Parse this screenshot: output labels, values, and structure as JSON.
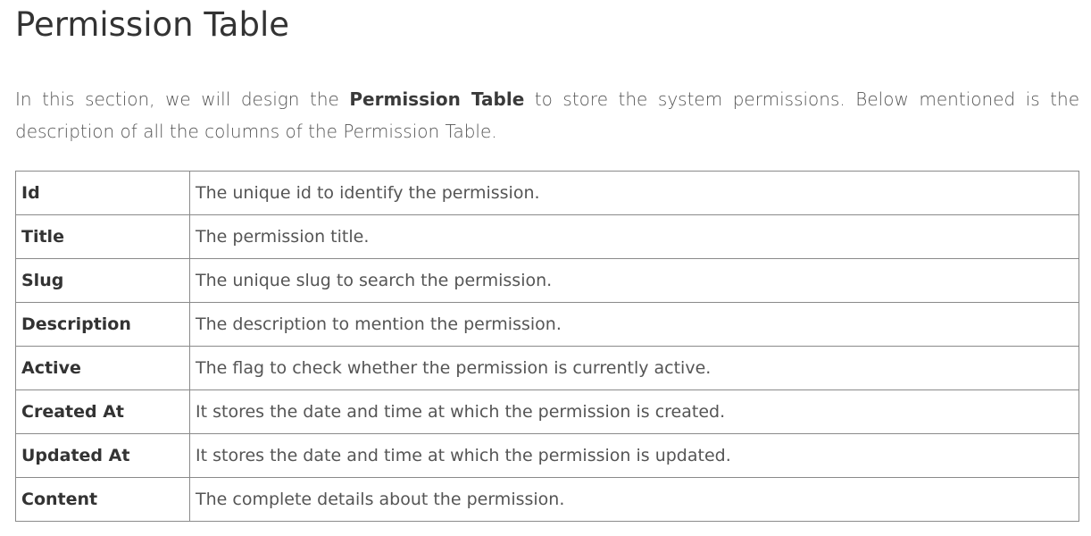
{
  "heading": "Permission Table",
  "intro": {
    "before": "In this section, we will design the ",
    "strong": "Permission Table",
    "after": " to store the system permissions. Below mentioned is the description of all the columns of the Permission Table."
  },
  "table": {
    "rows": [
      {
        "name": "Id",
        "description": "The unique id to identify the permission."
      },
      {
        "name": "Title",
        "description": "The permission title."
      },
      {
        "name": "Slug",
        "description": "The unique slug to search the permission."
      },
      {
        "name": "Description",
        "description": "The description to mention the permission."
      },
      {
        "name": "Active",
        "description": "The flag to check whether the permission is currently active."
      },
      {
        "name": "Created At",
        "description": "It stores the date and time at which the permission is created."
      },
      {
        "name": "Updated At",
        "description": "It stores the date and time at which the permission is updated."
      },
      {
        "name": "Content",
        "description": "The complete details about the permission."
      }
    ]
  }
}
